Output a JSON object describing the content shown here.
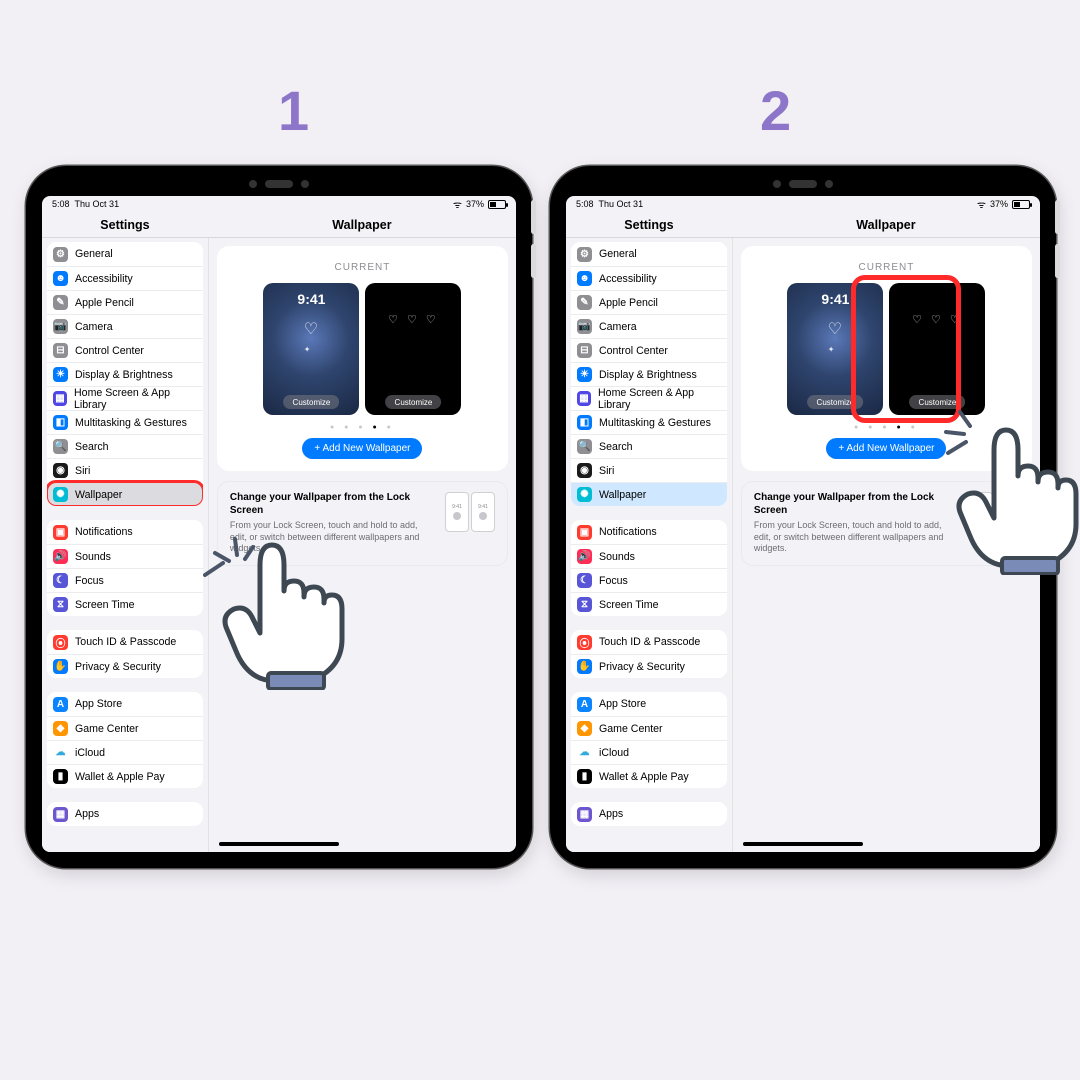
{
  "steps": [
    "1",
    "2"
  ],
  "status": {
    "time": "5:08",
    "date": "Thu Oct 31",
    "battery": "37%"
  },
  "titles": {
    "left": "Settings",
    "right": "Wallpaper"
  },
  "sidebar": {
    "g1": [
      {
        "l": "General",
        "c": "#8e8e93",
        "g": "⚙"
      },
      {
        "l": "Accessibility",
        "c": "#007aff",
        "g": "☻"
      },
      {
        "l": "Apple Pencil",
        "c": "#8e8e93",
        "g": "✎"
      },
      {
        "l": "Camera",
        "c": "#8e8e93",
        "g": "📷"
      },
      {
        "l": "Control Center",
        "c": "#8e8e93",
        "g": "⊟"
      },
      {
        "l": "Display & Brightness",
        "c": "#007aff",
        "g": "☀"
      },
      {
        "l": "Home Screen & App Library",
        "c": "#4f46e5",
        "g": "▦"
      },
      {
        "l": "Multitasking & Gestures",
        "c": "#007aff",
        "g": "◧"
      },
      {
        "l": "Search",
        "c": "#8e8e93",
        "g": "🔍"
      },
      {
        "l": "Siri",
        "c": "#1a1a1a",
        "g": "◉"
      },
      {
        "l": "Wallpaper",
        "c": "#00bcd4",
        "g": "✺"
      }
    ],
    "g2": [
      {
        "l": "Notifications",
        "c": "#ff3b30",
        "g": "▣"
      },
      {
        "l": "Sounds",
        "c": "#ff2d55",
        "g": "🔊"
      },
      {
        "l": "Focus",
        "c": "#5856d6",
        "g": "☾"
      },
      {
        "l": "Screen Time",
        "c": "#5856d6",
        "g": "⧖"
      }
    ],
    "g3": [
      {
        "l": "Touch ID & Passcode",
        "c": "#ff3b30",
        "g": "⦿"
      },
      {
        "l": "Privacy & Security",
        "c": "#007aff",
        "g": "✋"
      }
    ],
    "g4": [
      {
        "l": "App Store",
        "c": "#0a84ff",
        "g": "A"
      },
      {
        "l": "Game Center",
        "c": "#ff9500",
        "g": "◆"
      },
      {
        "l": "iCloud",
        "c": "#ffffff",
        "g": "☁",
        "fg": "#34aadc"
      },
      {
        "l": "Wallet & Apple Pay",
        "c": "#000",
        "g": "▮"
      }
    ],
    "g5": [
      {
        "l": "Apps",
        "c": "#6e56cf",
        "g": "▦"
      }
    ]
  },
  "detail": {
    "current": "CURRENT",
    "time": "9:41",
    "customize": "Customize",
    "add": "+ Add New Wallpaper",
    "tip_title": "Change your Wallpaper from the Lock Screen",
    "tip_desc": "From your Lock Screen, touch and hold to add, edit, or switch between different wallpapers and widgets.",
    "mini_time": "9:41"
  }
}
